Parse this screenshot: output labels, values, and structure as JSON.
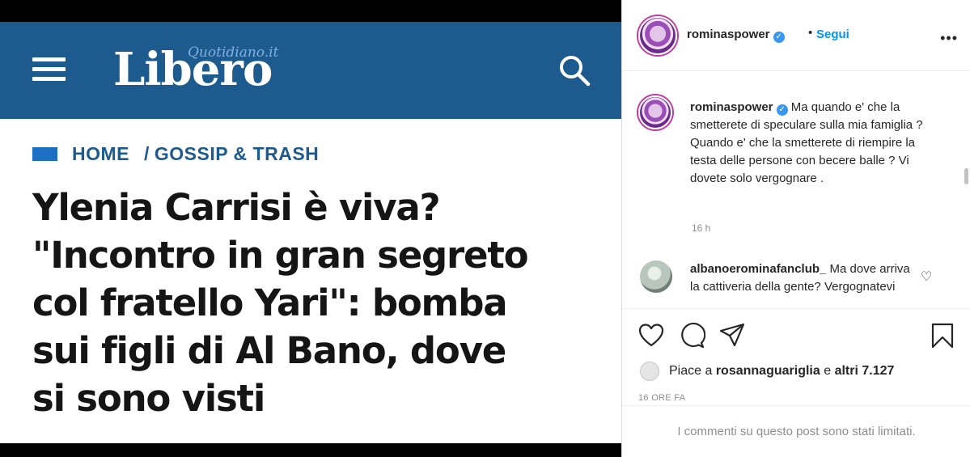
{
  "article": {
    "logo_main": "Libero",
    "logo_sub": "Quotidiano.it",
    "breadcrumb": {
      "home": "HOME",
      "separator": "/",
      "category": "GOSSIP & TRASH"
    },
    "headline_lines": [
      "Ylenia Carrisi è viva?",
      "\"Incontro in gran segreto",
      "col fratello Yari\": bomba",
      "sui figli di Al Bano, dove",
      "si sono visti"
    ],
    "colors": {
      "header": "#1d5b8f",
      "accent": "#1d6fc4"
    }
  },
  "post": {
    "username": "rominaspower",
    "separator": "•",
    "follow_label": "Segui",
    "more_label": "•••",
    "caption": {
      "username": "rominaspower",
      "text": "Ma quando e' che la smetterete di speculare sulla mia famiglia ? Quando e' che la smetterete di riempire la testa delle persone con becere balle ? Vi dovete solo vergognare .",
      "time": "16 h"
    },
    "comments": [
      {
        "username": "albanoerominafanclub_",
        "text": "Ma dove arriva la cattiveria della gente? Vergognatevi"
      }
    ],
    "likes": {
      "prefix": "Piace a",
      "user": "rosannaguariglia",
      "joiner": "e",
      "others": "altri 7.127"
    },
    "date": "16 ORE FA",
    "comments_limited": "I commenti su questo post sono stati limitati.",
    "icons": [
      "heart-icon",
      "comment-icon",
      "share-icon",
      "bookmark-icon"
    ],
    "colors": {
      "link": "#0095f6",
      "verified": "#3897f0",
      "muted": "#8e8e8e"
    }
  }
}
